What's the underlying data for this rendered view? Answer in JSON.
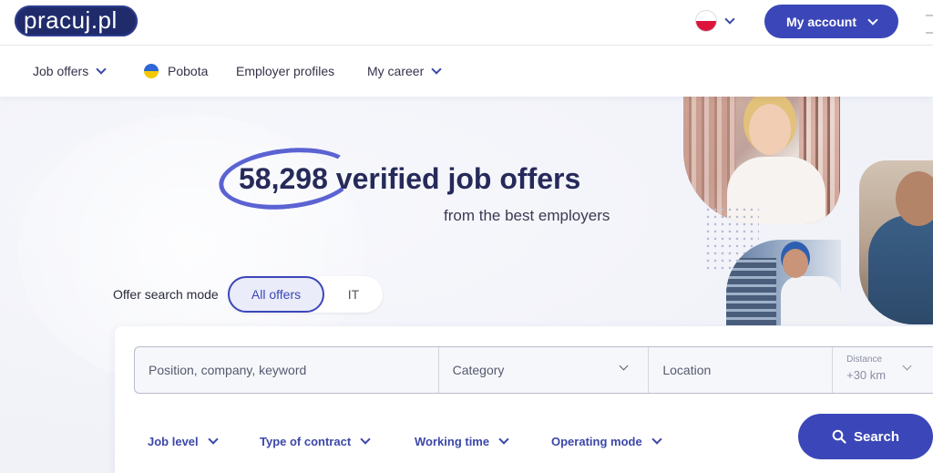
{
  "header": {
    "logo_text": "pracuj.pl",
    "account_label": "My account",
    "brand_color": "#3b47b8"
  },
  "nav": {
    "items": [
      {
        "label": "Job offers",
        "has_dropdown": true
      },
      {
        "label": "Pobota",
        "icon": "ukraine-flag-icon"
      },
      {
        "label": "Employer profiles"
      },
      {
        "label": "My career",
        "has_dropdown": true
      }
    ]
  },
  "hero": {
    "count": "58,298",
    "headline_rest": "verified job offers",
    "subheadline": "from the best employers"
  },
  "search_mode": {
    "label": "Offer search mode",
    "options": [
      "All offers",
      "IT"
    ],
    "selected": "All offers"
  },
  "search": {
    "position_placeholder": "Position, company, keyword",
    "category_placeholder": "Category",
    "location_placeholder": "Location",
    "distance_label": "Distance",
    "distance_value": "+30 km",
    "filters": [
      "Job level",
      "Type of contract",
      "Working time",
      "Operating mode"
    ],
    "button_label": "Search"
  }
}
